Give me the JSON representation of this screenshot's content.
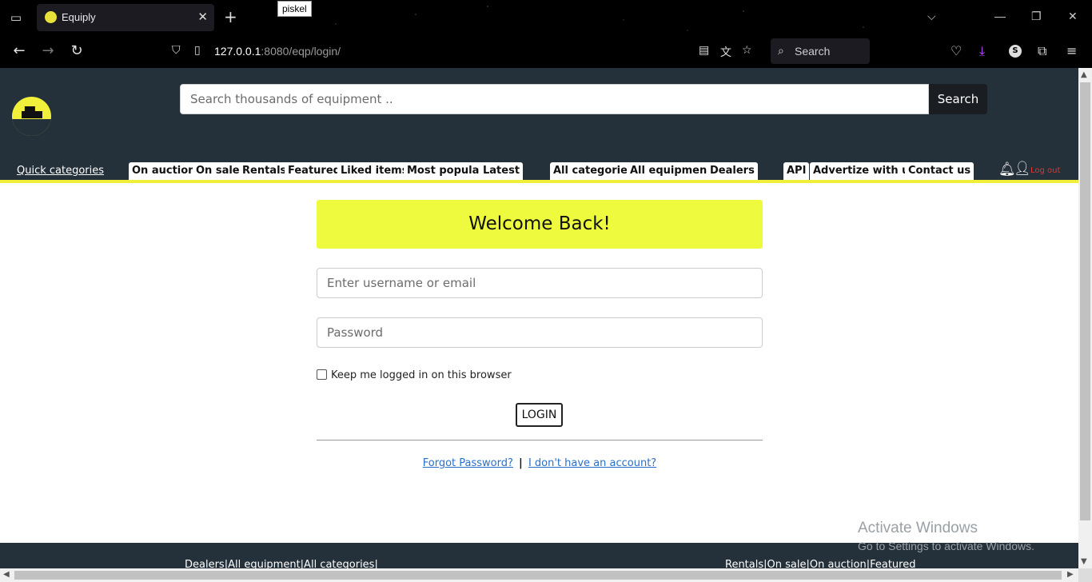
{
  "browser": {
    "tab_title": "Equiply",
    "tooltip": "piskel",
    "url_host": "127.0.0.1",
    "url_rest": ":8080/eqp/login/",
    "search_label": "Search",
    "profile_initial": "S"
  },
  "header": {
    "search_placeholder": "Search thousands of equipment ..",
    "search_button": "Search",
    "quick_categories": "Quick categories",
    "nav_group1": [
      "On auction",
      "On sale",
      "Rentals",
      "Featured",
      "Liked items",
      "Most popular",
      "Latest"
    ],
    "nav_group2": [
      "All categories",
      "All equipment",
      "Dealers"
    ],
    "nav_group3": [
      "API",
      "Advertize with us",
      "Contact us"
    ],
    "logout": "Log out"
  },
  "login": {
    "welcome": "Welcome Back!",
    "username_placeholder": "Enter username or email",
    "password_placeholder": "Password",
    "remember_label": "Keep me logged in on this browser",
    "login_button": "LOGIN",
    "forgot_link": "Forgot Password?",
    "separator": "|",
    "signup_link": "I don't have an account?"
  },
  "footer": {
    "left_links": "Dealers|All equipment|All categories|",
    "right_links": "Rentals|On sale|On auction|Featured"
  },
  "os_overlay": {
    "activate_title": "Activate Windows",
    "activate_sub": "Go to Settings to activate Windows."
  }
}
